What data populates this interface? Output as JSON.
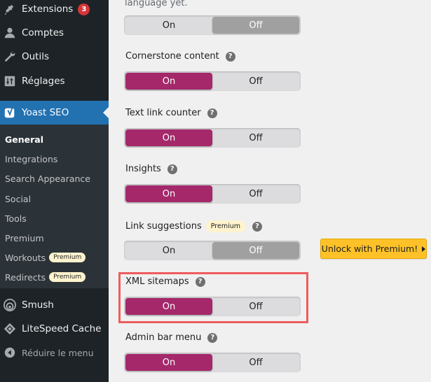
{
  "sidebar": {
    "items": [
      {
        "label": "Extensions",
        "icon": "plugin-icon",
        "badge": "3"
      },
      {
        "label": "Comptes",
        "icon": "user-icon"
      },
      {
        "label": "Outils",
        "icon": "wrench-icon"
      },
      {
        "label": "Réglages",
        "icon": "settings-sliders-icon"
      }
    ],
    "current": {
      "label": "Yoast SEO",
      "icon": "yoast-icon"
    },
    "submenu": [
      {
        "label": "General",
        "active": true
      },
      {
        "label": "Integrations"
      },
      {
        "label": "Search Appearance"
      },
      {
        "label": "Social"
      },
      {
        "label": "Tools"
      },
      {
        "label": "Premium"
      },
      {
        "label": "Workouts",
        "pill": "Premium"
      },
      {
        "label": "Redirects",
        "pill": "Premium"
      }
    ],
    "after": [
      {
        "label": "Smush",
        "icon": "smush-icon"
      },
      {
        "label": "LiteSpeed Cache",
        "icon": "litespeed-icon"
      }
    ],
    "collapse": {
      "label": "Réduire le menu",
      "icon": "collapse-arrow-icon"
    }
  },
  "main": {
    "intro_text": "language yet.",
    "toggle_on": "On",
    "toggle_off": "Off",
    "help_glyph": "?",
    "features": [
      {
        "label": "",
        "state": "off"
      },
      {
        "label": "Cornerstone content",
        "state": "on"
      },
      {
        "label": "Text link counter",
        "state": "on"
      },
      {
        "label": "Insights",
        "state": "on"
      },
      {
        "label": "Link suggestions",
        "premium": "Premium",
        "state": "off"
      },
      {
        "label": "XML sitemaps",
        "state": "on",
        "highlighted": true
      },
      {
        "label": "Admin bar menu",
        "state": "on"
      }
    ],
    "unlock_button": "Unlock with Premium!"
  },
  "colors": {
    "sidebar_bg": "#1d2327",
    "submenu_bg": "#2c3338",
    "current_bg": "#2271b1",
    "toggle_on": "#a4286a",
    "toggle_off_selected": "#a0a0a0",
    "premium_pill": "#fff3cd",
    "unlock_button": "#fec228",
    "highlight_border": "#ee5c5c",
    "badge": "#d63638"
  }
}
